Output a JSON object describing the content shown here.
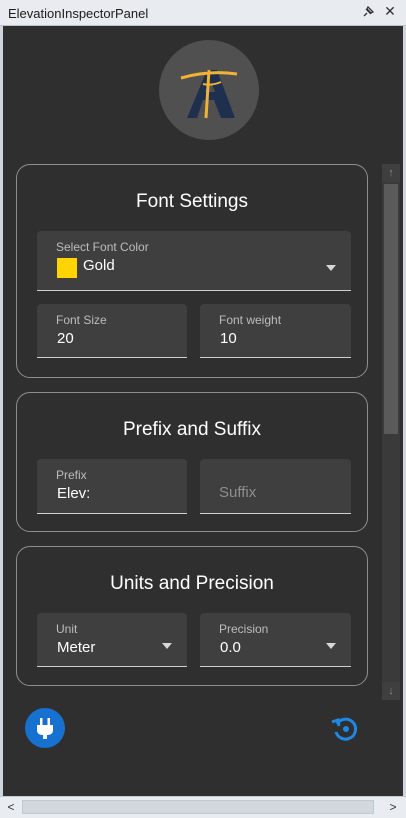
{
  "window": {
    "title": "ElevationInspectorPanel",
    "close_glyph": "✕"
  },
  "font_settings": {
    "title": "Font Settings",
    "color_label": "Select Font Color",
    "color_value": "Gold",
    "color_hex": "#ffd400",
    "size_label": "Font Size",
    "size_value": "20",
    "weight_label": "Font weight",
    "weight_value": "10"
  },
  "prefix_suffix": {
    "title": "Prefix and Suffix",
    "prefix_label": "Prefix",
    "prefix_value": "Elev:",
    "suffix_placeholder": "Suffix"
  },
  "units_precision": {
    "title": "Units and Precision",
    "unit_label": "Unit",
    "unit_value": "Meter",
    "precision_label": "Precision",
    "precision_value": "0.0"
  },
  "icons": {
    "logo": "logo-icon",
    "plug": "plug-icon",
    "reset": "reset-icon",
    "pin": "pin-icon"
  },
  "colors": {
    "accent": "#1771d1",
    "panel_bg": "#2f2f2f",
    "field_bg": "#3f3f3f"
  },
  "scroll_arrows": {
    "up": "↑",
    "down": "↓",
    "left": "<",
    "right": ">"
  }
}
